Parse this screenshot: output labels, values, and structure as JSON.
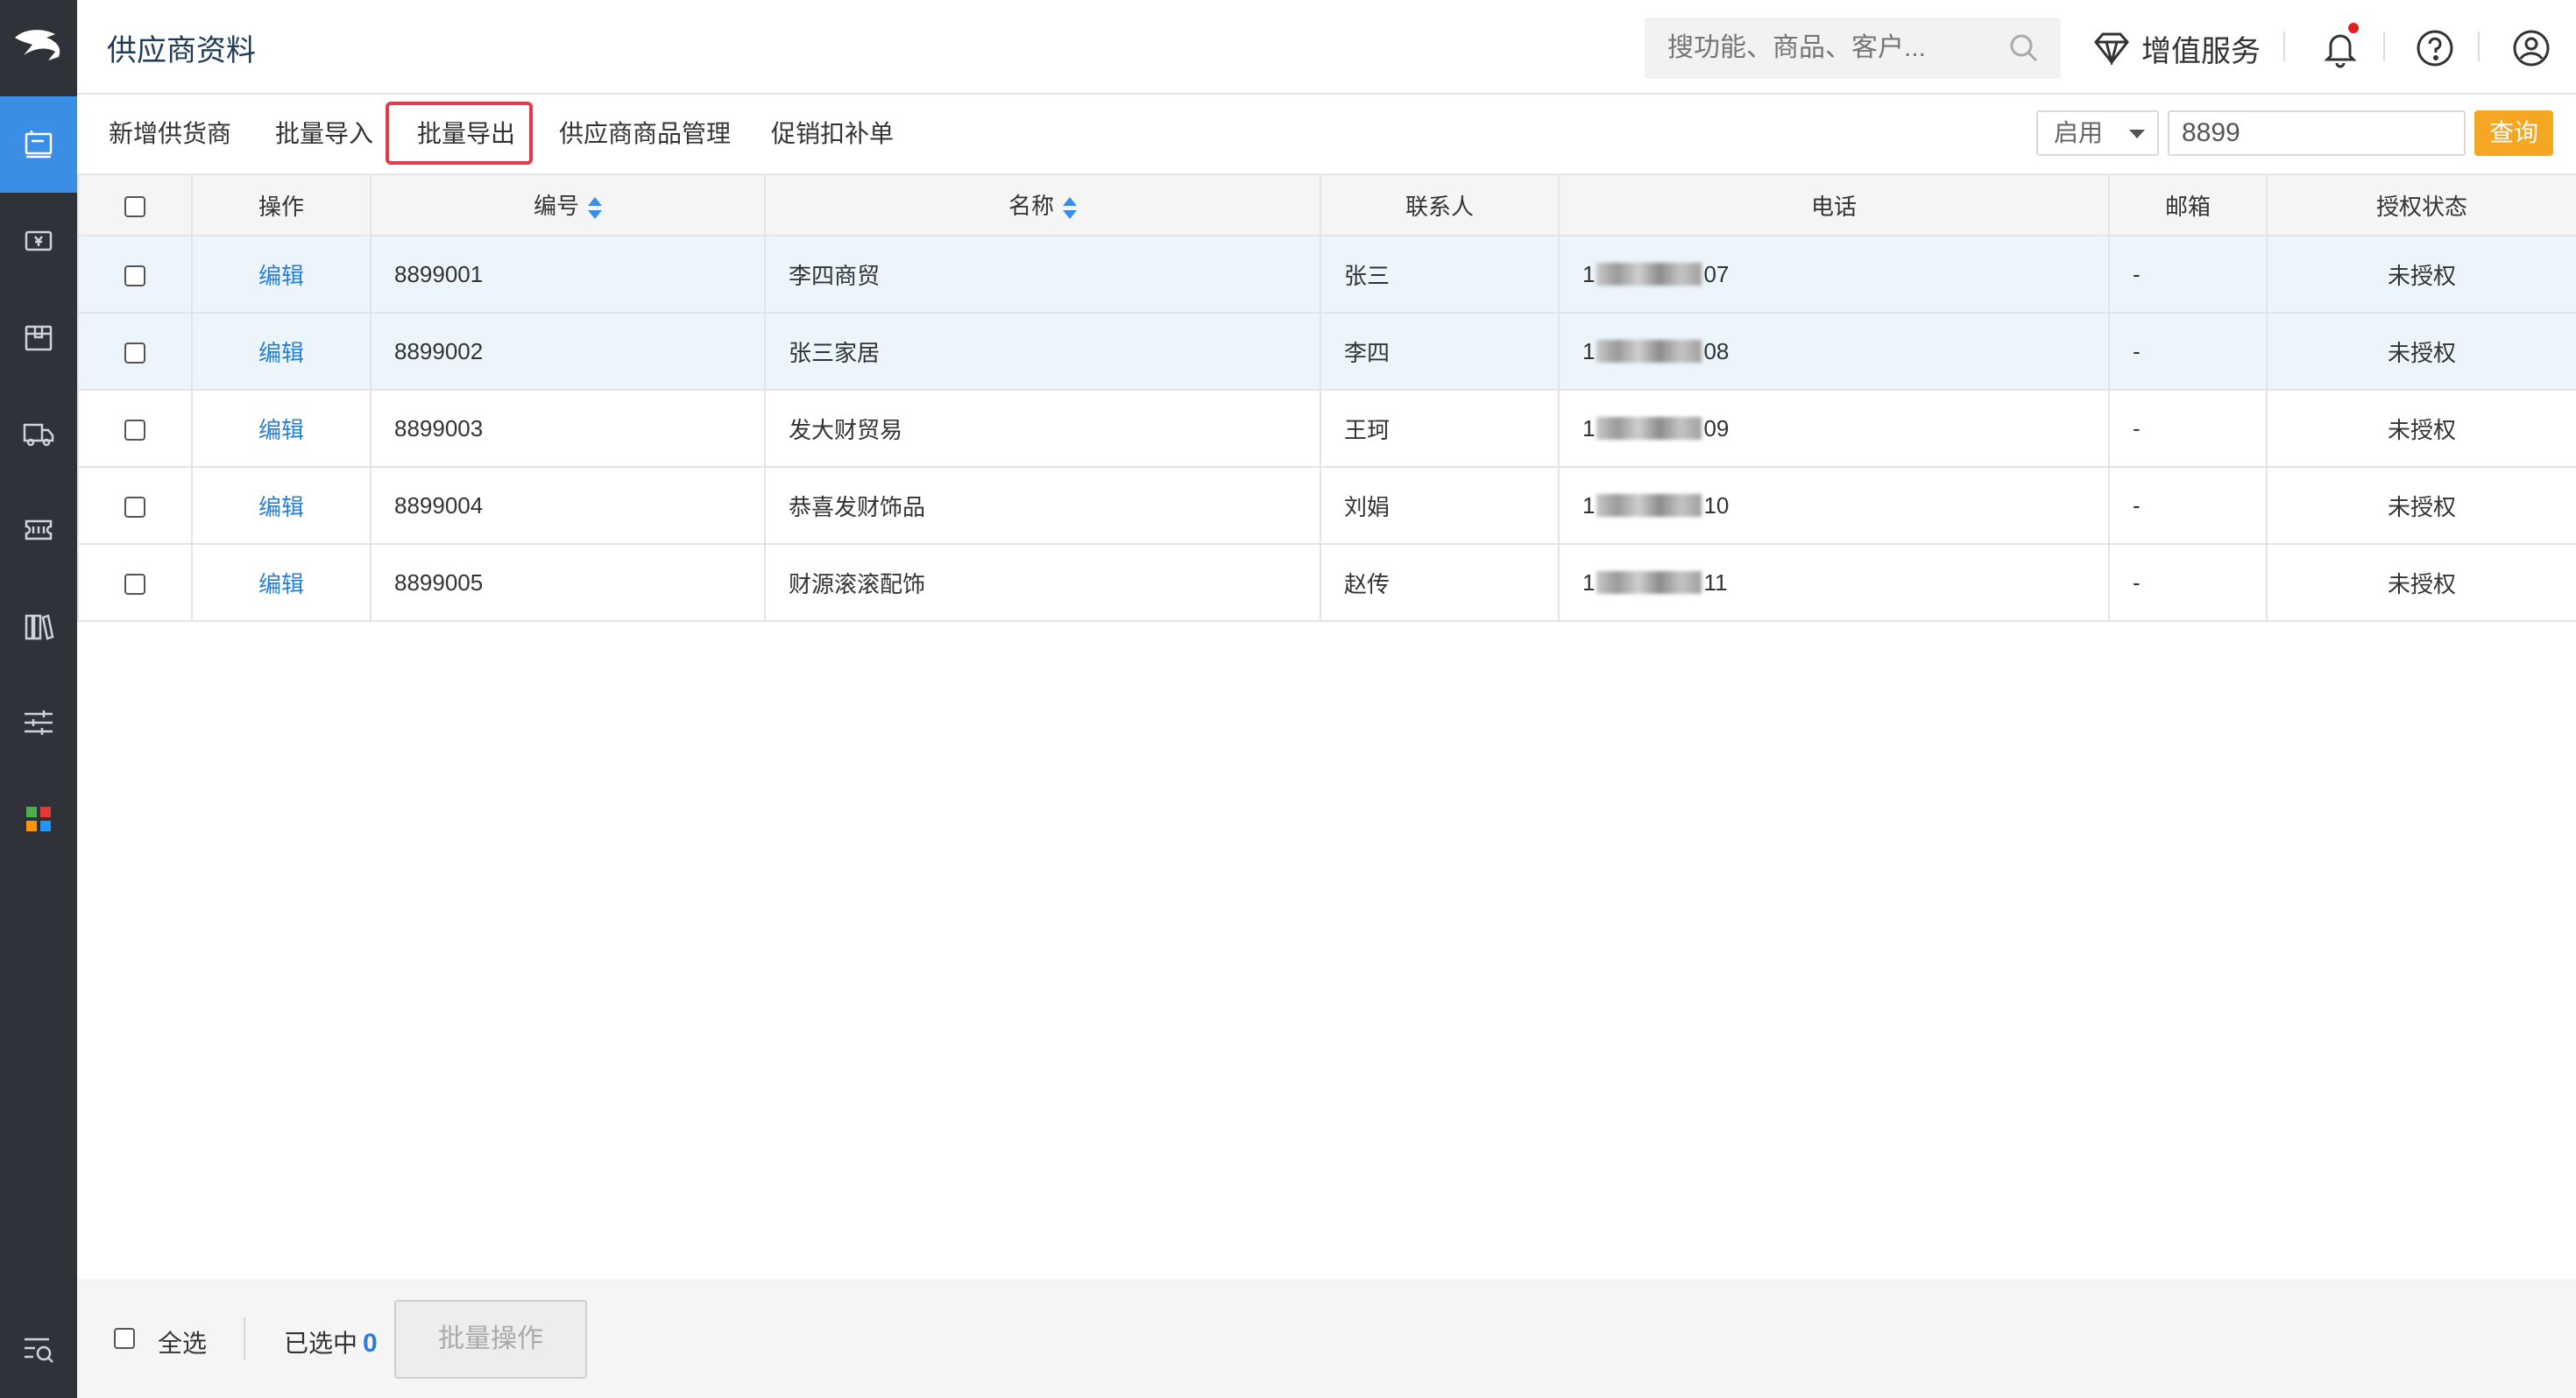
{
  "header": {
    "title": "供应商资料",
    "search_placeholder": "搜功能、商品、客户...",
    "value_added_service": "增值服务"
  },
  "sidebar": {
    "items": [
      {
        "icon": "supplier-icon",
        "active": true
      },
      {
        "icon": "cash-icon",
        "active": false
      },
      {
        "icon": "package-icon",
        "active": false
      },
      {
        "icon": "truck-icon",
        "active": false
      },
      {
        "icon": "ticket-icon",
        "active": false
      },
      {
        "icon": "books-icon",
        "active": false
      },
      {
        "icon": "sliders-icon",
        "active": false
      },
      {
        "icon": "apps-icon",
        "active": false
      }
    ],
    "bottom_icon": "menu-search-icon"
  },
  "toolbar": {
    "add_supplier": "新增供货商",
    "batch_import": "批量导入",
    "batch_export": "批量导出",
    "supplier_goods": "供应商商品管理",
    "promo_deduction": "促销扣补单",
    "status_value": "启用",
    "keyword_value": "8899",
    "query_label": "查询"
  },
  "table": {
    "headers": {
      "action": "操作",
      "code": "编号",
      "name": "名称",
      "contact": "联系人",
      "phone": "电话",
      "email": "邮箱",
      "auth": "授权状态"
    },
    "rows": [
      {
        "action": "编辑",
        "code": "8899001",
        "name": "李四商贸",
        "contact": "张三",
        "phone_start": "1",
        "phone_end": "07",
        "email": "-",
        "auth": "未授权"
      },
      {
        "action": "编辑",
        "code": "8899002",
        "name": "张三家居",
        "contact": "李四",
        "phone_start": "1",
        "phone_end": "08",
        "email": "-",
        "auth": "未授权"
      },
      {
        "action": "编辑",
        "code": "8899003",
        "name": "发大财贸易",
        "contact": "王珂",
        "phone_start": "1",
        "phone_end": "09",
        "email": "-",
        "auth": "未授权"
      },
      {
        "action": "编辑",
        "code": "8899004",
        "name": "恭喜发财饰品",
        "contact": "刘娟",
        "phone_start": "1",
        "phone_end": "10",
        "email": "-",
        "auth": "未授权"
      },
      {
        "action": "编辑",
        "code": "8899005",
        "name": "财源滚滚配饰",
        "contact": "赵传",
        "phone_start": "1",
        "phone_end": "11",
        "email": "-",
        "auth": "未授权"
      }
    ]
  },
  "footer": {
    "select_all": "全选",
    "selected_label": "已选中",
    "selected_count": "0",
    "batch_action": "批量操作"
  },
  "colors": {
    "accent": "#3a8ee6",
    "query_button": "#f5a623",
    "highlight_border": "#e5384a",
    "row_highlight": "#ebf5fb",
    "sidebar_bg": "#2f3238"
  }
}
